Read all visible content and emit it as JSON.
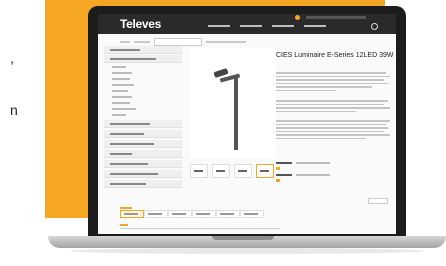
{
  "left_text": {
    "line1": ",",
    "line2": "n"
  },
  "site": {
    "logo": "Televes"
  },
  "product": {
    "title": "CIES Luminaire E-Series 12LED 39W"
  },
  "colors": {
    "accent": "#f5a623",
    "header": "#2a2a2a",
    "bezel": "#1c1c1c"
  }
}
